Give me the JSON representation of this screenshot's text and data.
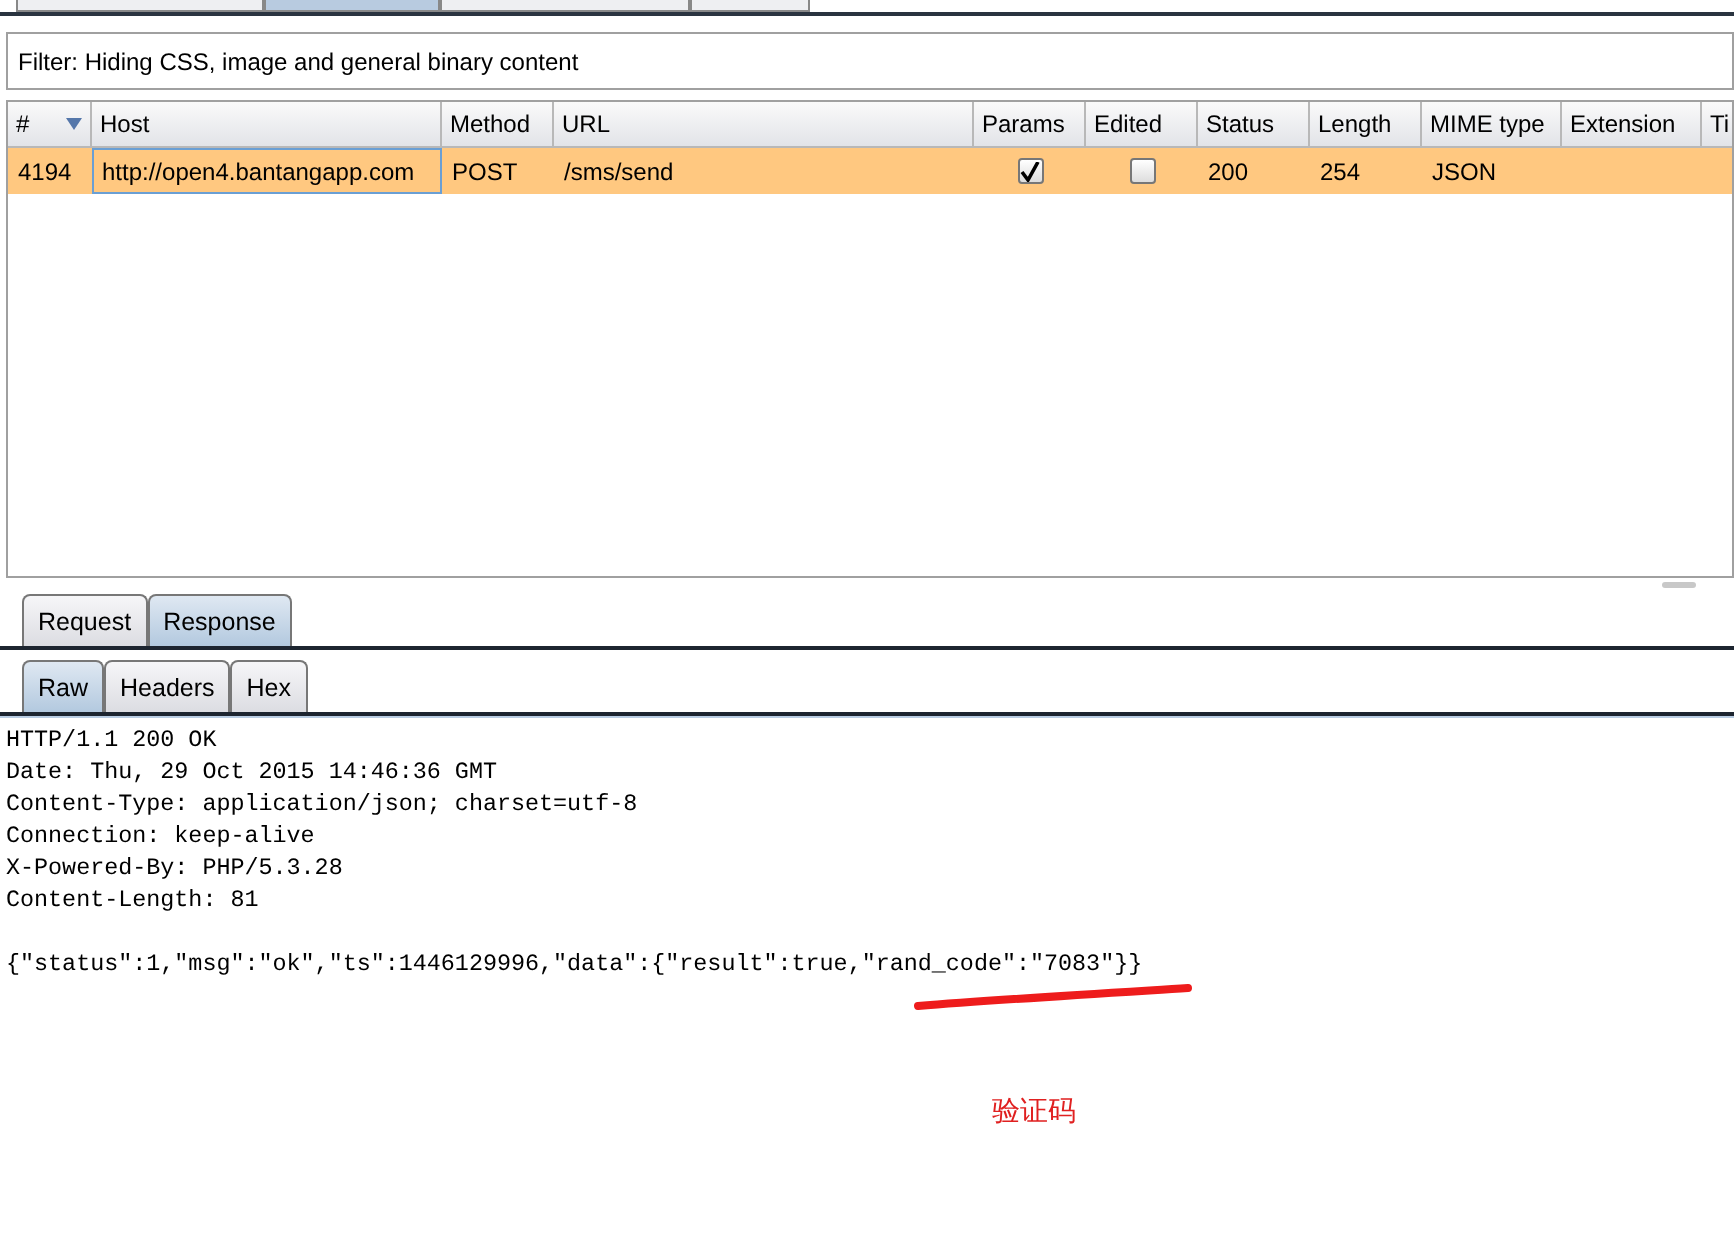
{
  "top_tabs": [
    {
      "selected": false
    },
    {
      "selected": true
    },
    {
      "selected": false
    },
    {
      "selected": false
    }
  ],
  "filter": {
    "text": "Filter: Hiding CSS, image and general binary content"
  },
  "table": {
    "columns": [
      {
        "label": "#",
        "sort_descending": true
      },
      {
        "label": "Host"
      },
      {
        "label": "Method"
      },
      {
        "label": "URL"
      },
      {
        "label": "Params"
      },
      {
        "label": "Edited"
      },
      {
        "label": "Status"
      },
      {
        "label": "Length"
      },
      {
        "label": "MIME type"
      },
      {
        "label": "Extension"
      },
      {
        "label": "Ti"
      }
    ],
    "rows": [
      {
        "selected": true,
        "cells": [
          {
            "kind": "text",
            "text": "4194"
          },
          {
            "kind": "text",
            "text": "http://open4.bantangapp.com",
            "focused": true
          },
          {
            "kind": "text",
            "text": "POST"
          },
          {
            "kind": "text",
            "text": "/sms/send"
          },
          {
            "kind": "check",
            "checked": true
          },
          {
            "kind": "check",
            "checked": false
          },
          {
            "kind": "text",
            "text": "200"
          },
          {
            "kind": "text",
            "text": "254"
          },
          {
            "kind": "text",
            "text": "JSON"
          },
          {
            "kind": "blank"
          },
          {
            "kind": "blank"
          }
        ]
      }
    ]
  },
  "message_tabs": [
    {
      "label": "Request",
      "selected": false
    },
    {
      "label": "Response",
      "selected": true
    }
  ],
  "view_tabs": [
    {
      "label": "Raw",
      "selected": true
    },
    {
      "label": "Headers",
      "selected": false
    },
    {
      "label": "Hex",
      "selected": false
    }
  ],
  "response": {
    "header_lines": [
      "HTTP/1.1 200 OK",
      "Date: Thu, 29 Oct 2015 14:46:36 GMT",
      "Content-Type: application/json; charset=utf-8",
      "Connection: keep-alive",
      "X-Powered-By: PHP/5.3.28",
      "Content-Length: 81"
    ],
    "body": "{\"status\":1,\"msg\":\"ok\",\"ts\":1446129996,\"data\":{\"result\":true,\"rand_code\":\"7083\"}}"
  },
  "annotation": {
    "text": "验证码"
  }
}
